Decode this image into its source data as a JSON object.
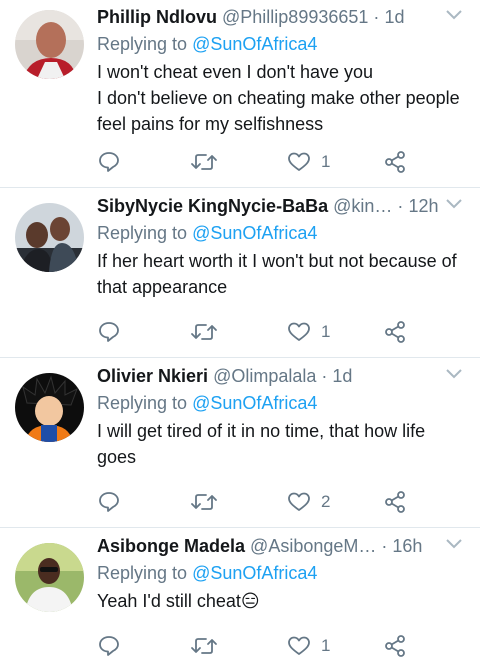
{
  "colors": {
    "text": "#14171a",
    "muted": "#657786",
    "link": "#1da1f2",
    "divider": "#e1e8ed"
  },
  "tweets": [
    {
      "name": "Phillip Ndlovu",
      "handle": "@Phillip89936651",
      "dot": "·",
      "time": "1d",
      "reply_prefix": "Replying to",
      "reply_to": "@SunOfAfrica4",
      "lines": [
        "I won't cheat even I don't have you",
        "I don't believe on cheating make other people feel pains for my selfishness"
      ],
      "like_count": "1"
    },
    {
      "name": "SibyNycie KingNycie-BaBa",
      "handle": "@kin…",
      "dot": "·",
      "time": "12h",
      "reply_prefix": "Replying to",
      "reply_to": "@SunOfAfrica4",
      "lines": [
        "If her heart worth it I won't but not because of that appearance"
      ],
      "like_count": "1"
    },
    {
      "name": "Olivier Nkieri",
      "handle": "@Olimpalala",
      "dot": "·",
      "time": "1d",
      "reply_prefix": "Replying to",
      "reply_to": "@SunOfAfrica4",
      "lines": [
        "I will get tired of it in no time, that how life goes"
      ],
      "like_count": "2"
    },
    {
      "name": "Asibonge Madela",
      "handle": "@AsibongeM…",
      "dot": "·",
      "time": "16h",
      "reply_prefix": "Replying to",
      "reply_to": "@SunOfAfrica4",
      "lines": [
        "Yeah I'd still cheat😑"
      ],
      "like_count": "1"
    }
  ],
  "icons": [
    "reply-icon",
    "retweet-icon",
    "like-icon",
    "share-icon",
    "chevron-down-icon"
  ]
}
